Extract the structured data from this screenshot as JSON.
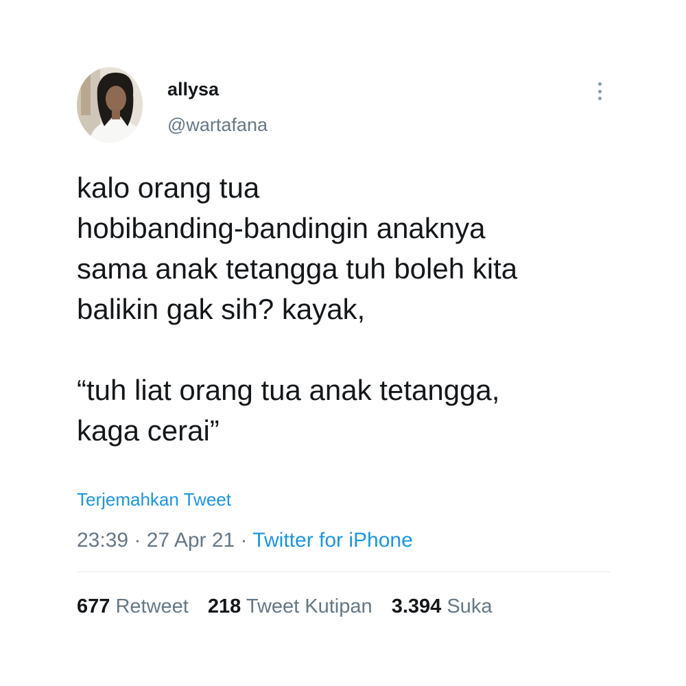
{
  "user": {
    "display_name": "allysa",
    "handle": "@wartafana"
  },
  "tweet": {
    "lines": [
      "kalo orang tua",
      "hobibanding-bandingin anaknya",
      "sama anak tetangga tuh boleh kita",
      "balikin gak sih? kayak,",
      "“tuh liat orang tua anak tetangga,",
      "kaga cerai”"
    ],
    "translate_label": "Terjemahkan Tweet",
    "time": "23:39",
    "separator": "·",
    "date": "27 Apr 21",
    "source": "Twitter for iPhone"
  },
  "stats": {
    "retweets": {
      "count": "677",
      "label": "Retweet"
    },
    "quotes": {
      "count": "218",
      "label": "Tweet Kutipan"
    },
    "likes": {
      "count": "3.394",
      "label": "Suka"
    }
  },
  "icons": {
    "more": "more-vertical-icon"
  },
  "colors": {
    "link": "#1b95e0",
    "text": "#14171a",
    "secondary": "#657786"
  }
}
